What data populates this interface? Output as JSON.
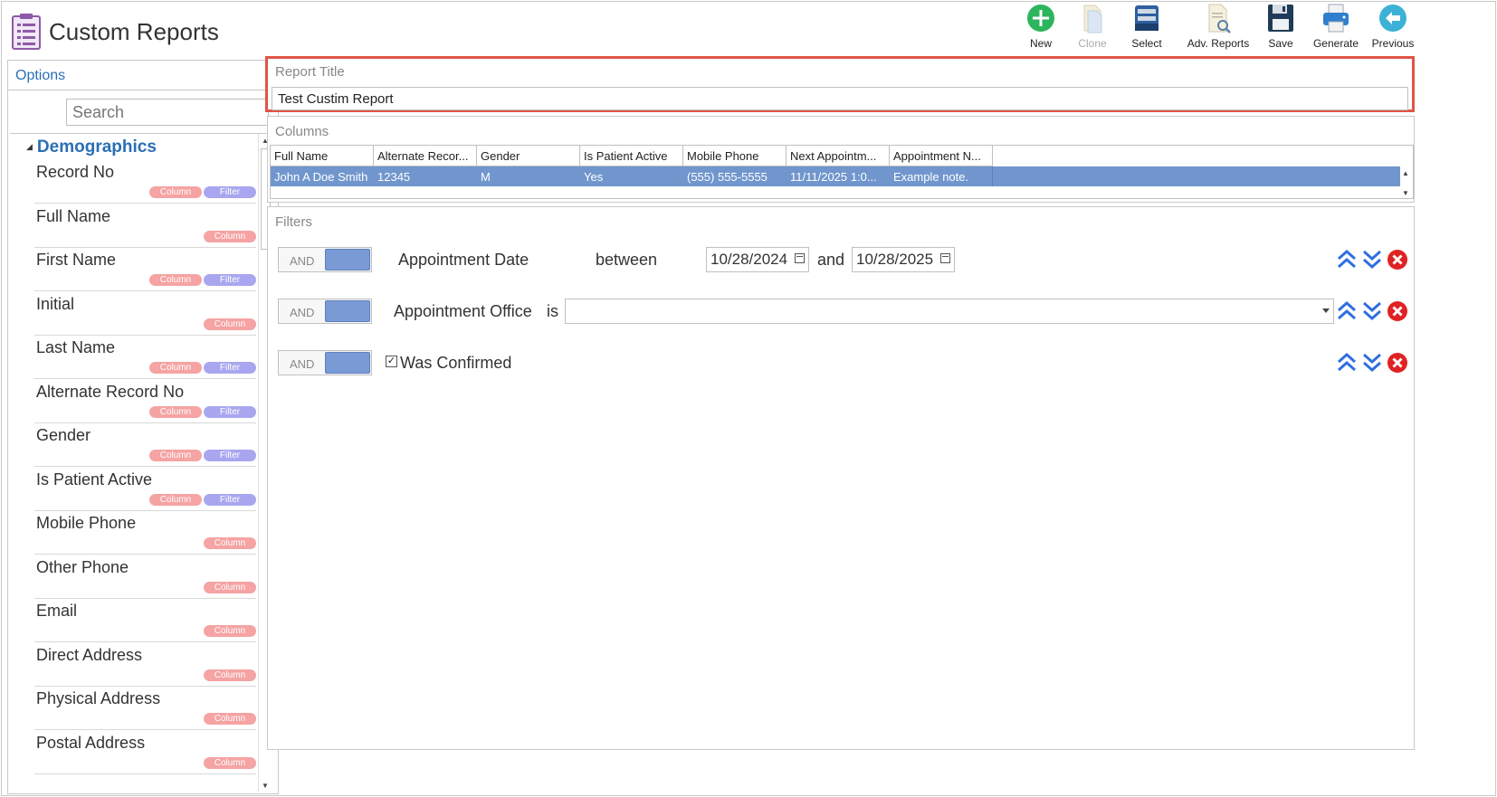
{
  "header": {
    "title": "Custom Reports",
    "icon": "report-list-icon"
  },
  "toolbar": {
    "new_label": "New",
    "clone_label": "Clone",
    "select_label": "Select",
    "adv_reports_label": "Adv. Reports",
    "save_label": "Save",
    "generate_label": "Generate",
    "previous_label": "Previous"
  },
  "sidebar": {
    "title": "Options",
    "search_placeholder": "Search",
    "group": "Demographics",
    "column_tag": "Column",
    "filter_tag": "Filter",
    "fields": [
      {
        "label": "Record No",
        "filter": true
      },
      {
        "label": "Full Name",
        "filter": false
      },
      {
        "label": "First Name",
        "filter": true
      },
      {
        "label": "Initial",
        "filter": false
      },
      {
        "label": "Last Name",
        "filter": true
      },
      {
        "label": "Alternate Record No",
        "filter": true
      },
      {
        "label": "Gender",
        "filter": true
      },
      {
        "label": "Is Patient Active",
        "filter": true
      },
      {
        "label": "Mobile Phone",
        "filter": false
      },
      {
        "label": "Other Phone",
        "filter": false
      },
      {
        "label": "Email",
        "filter": false
      },
      {
        "label": "Direct Address",
        "filter": false
      },
      {
        "label": "Physical Address",
        "filter": false
      },
      {
        "label": "Postal Address",
        "filter": false
      }
    ]
  },
  "report_title": {
    "label": "Report Title",
    "value": "Test Custim Report"
  },
  "columns": {
    "label": "Columns",
    "headers": [
      "Full Name",
      "Alternate Recor...",
      "Gender",
      "Is Patient Active",
      "Mobile Phone",
      "Next Appointm...",
      "Appointment N..."
    ],
    "row": [
      "John A Doe Smith",
      "12345",
      "M",
      "Yes",
      "(555) 555-5555",
      "11/11/2025 1:0...",
      "Example note."
    ]
  },
  "filters": {
    "label": "Filters",
    "rows": [
      {
        "toggle": "AND",
        "field": "Appointment Date",
        "op": "between",
        "from": "10/28/2024",
        "and": "and",
        "to": "10/28/2025"
      },
      {
        "toggle": "AND",
        "field": "Appointment Office",
        "op": "is",
        "value": ""
      },
      {
        "toggle": "AND",
        "field": "Was Confirmed",
        "checked": true
      }
    ]
  },
  "colors": {
    "accent_blue": "#2a6fb5",
    "selected_row": "#7096cd",
    "highlight_border": "#e05545",
    "column_tag": "#f5a3a3",
    "filter_tag": "#a9a6f0"
  }
}
